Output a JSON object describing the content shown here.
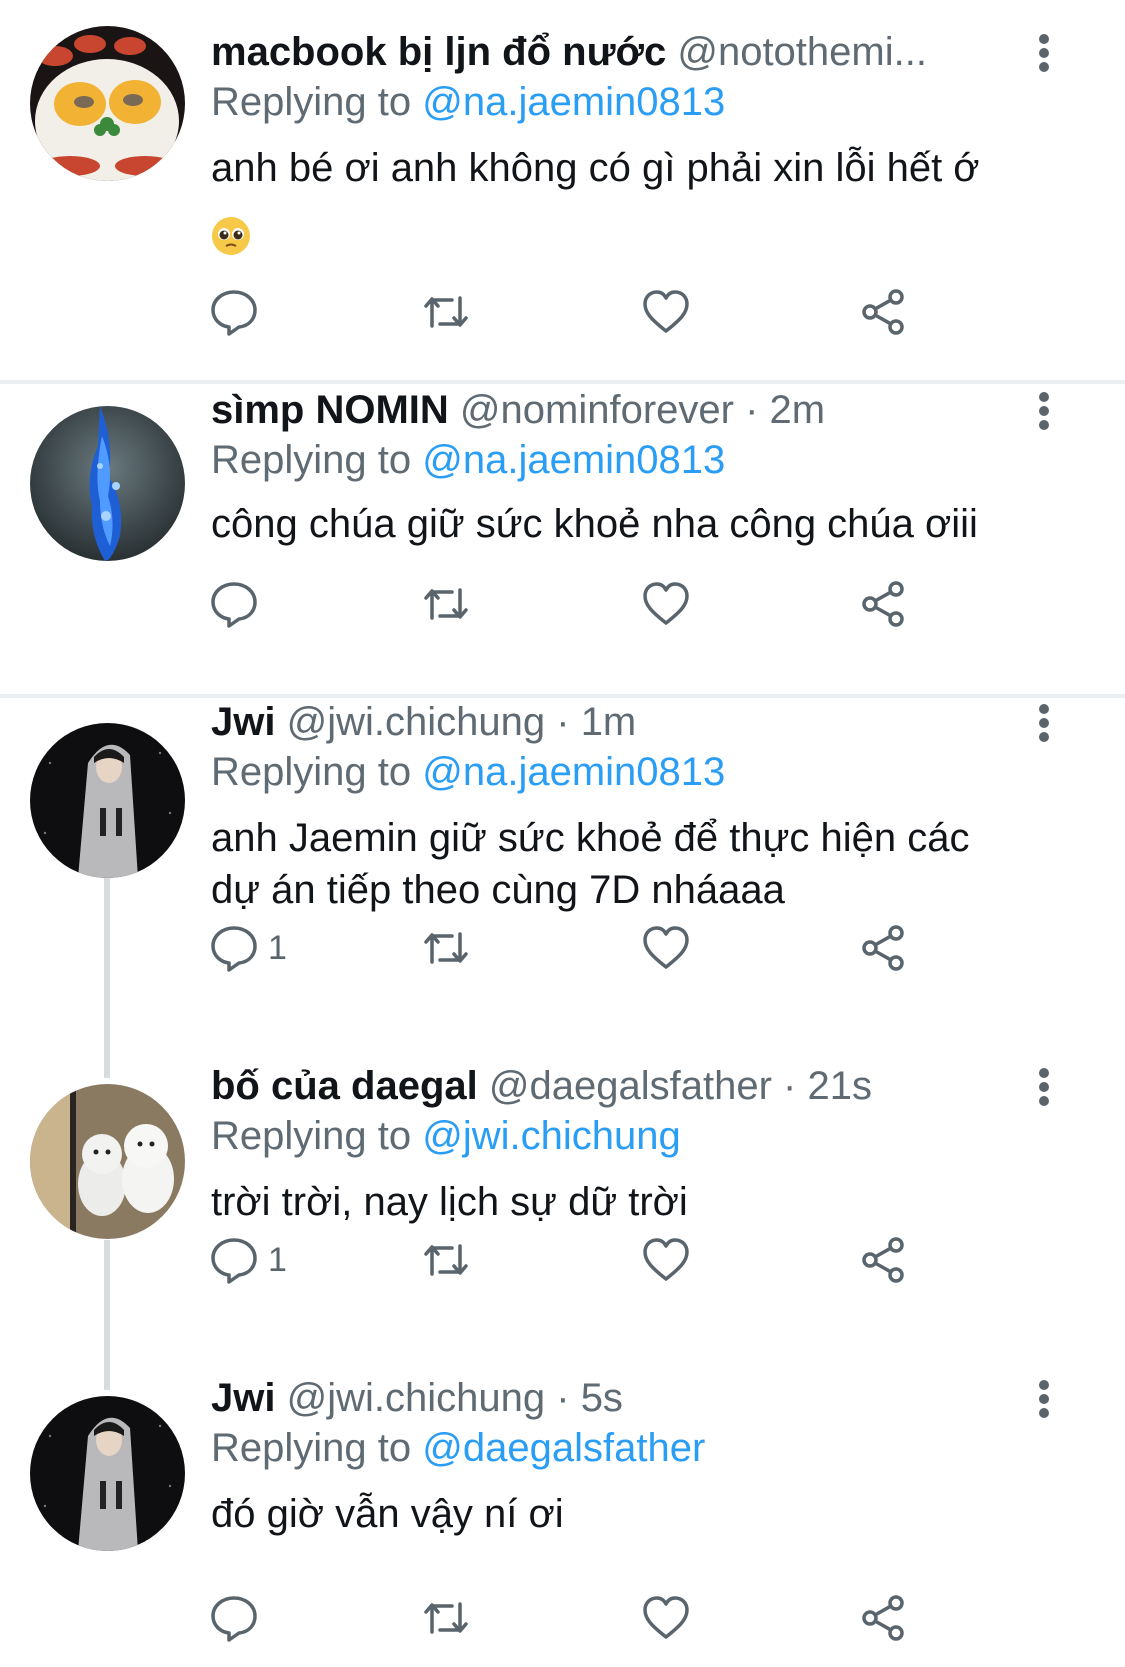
{
  "colors": {
    "accent": "#2a9df4",
    "name": "#111418",
    "secondary": "#5f6a73",
    "icon": "#59646c",
    "divider": "#eceff1",
    "thread_line": "#d6dce0"
  },
  "tweets": [
    {
      "name": "macbook bị ljn đổ nước",
      "handle": "@notothemi...",
      "time": "",
      "replying_prefix": "Replying to",
      "replying_to": "@na.jaemin0813",
      "text": "anh bé ơi anh không có gì phải xin lỗi hết ớ",
      "emoji": "pleading-face",
      "reply_count": "",
      "avatar": "cartoon-face-avatar"
    },
    {
      "name": "sìmp NOMIN",
      "handle": "@nominforever",
      "time": "2m",
      "replying_prefix": "Replying to",
      "replying_to": "@na.jaemin0813",
      "text": "công chúa giữ sức khoẻ nha công chúa ơiii",
      "reply_count": "",
      "avatar": "blue-fire-avatar"
    },
    {
      "name": "Jwi",
      "handle": "@jwi.chichung",
      "time": "1m",
      "replying_prefix": "Replying to",
      "replying_to": "@na.jaemin0813",
      "text_lines": [
        "anh Jaemin giữ sức khoẻ để thực hiện các",
        "dự án tiếp theo cùng 7D nháaaa"
      ],
      "reply_count": "1",
      "avatar": "hoodie-person-avatar"
    },
    {
      "name": "bố của daegal",
      "handle": "@daegalsfather",
      "time": "21s",
      "replying_prefix": "Replying to",
      "replying_to": "@jwi.chichung",
      "text": "trời trời, nay lịch sự dữ trời",
      "reply_count": "1",
      "avatar": "white-dogs-avatar"
    },
    {
      "name": "Jwi",
      "handle": "@jwi.chichung",
      "time": "5s",
      "replying_prefix": "Replying to",
      "replying_to": "@daegalsfather",
      "text": "đó giờ vẫn vậy ní ơi",
      "reply_count": "",
      "avatar": "hoodie-person-avatar"
    }
  ],
  "separator": "·",
  "action_icons": [
    "reply-icon",
    "retweet-icon",
    "like-icon",
    "share-icon"
  ]
}
